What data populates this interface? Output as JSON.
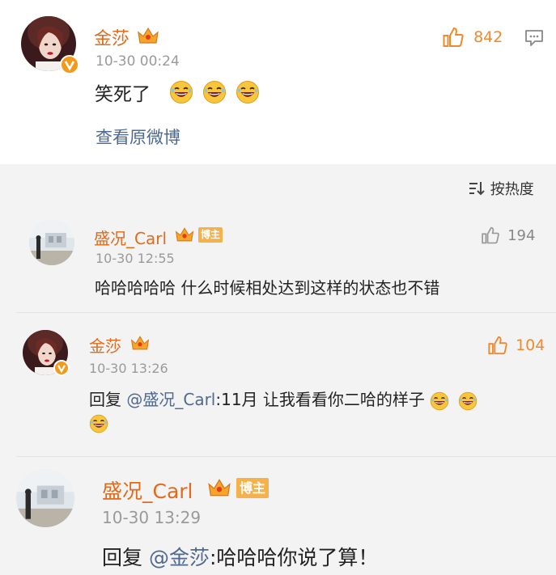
{
  "post": {
    "author": "金莎",
    "time": "10-30 00:24",
    "text": "笑死了",
    "likes": "842",
    "view_original": "查看原微博",
    "emoji_count": 3
  },
  "sort": {
    "label": "按热度"
  },
  "comments": [
    {
      "author": "盛况_Carl",
      "badge": "博主",
      "time": "10-30 12:55",
      "text": "哈哈哈哈哈 什么时候相处达到这样的状态也不错",
      "likes": "194"
    },
    {
      "author": "金莎",
      "time": "10-30 13:26",
      "reply_prefix": "回复 ",
      "mention": "@盛况_Carl",
      "text": ":11月 让我看看你二哈的样子",
      "likes": "104"
    },
    {
      "author": "盛况_Carl",
      "badge": "博主",
      "time": "10-30 13:29",
      "reply_prefix": "回复 ",
      "mention": "@金莎",
      "text": ":哈哈哈你说了算！"
    }
  ],
  "colors": {
    "name": "#e26a1b",
    "link": "#50698f",
    "like": "#f0892d",
    "badge": "#f6b24a",
    "crown": "#f4a52a"
  }
}
